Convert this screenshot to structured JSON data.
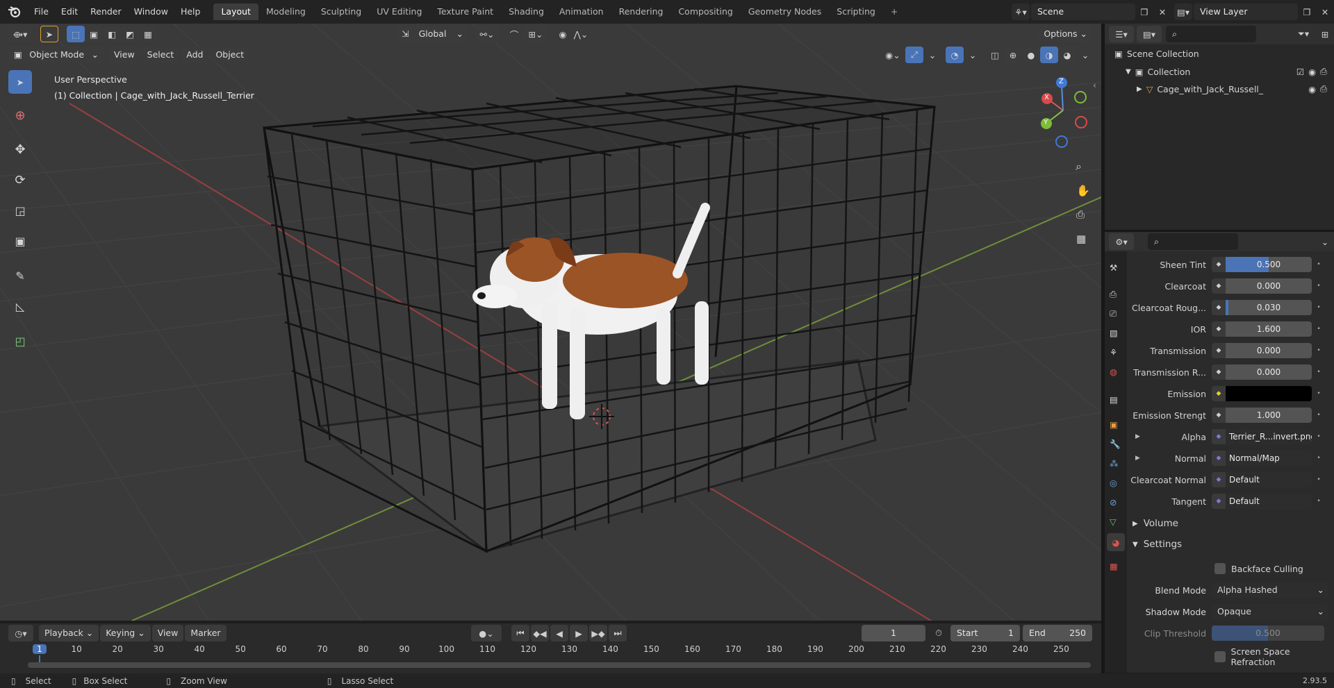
{
  "app": {
    "version": "2.93.5"
  },
  "menu": [
    "File",
    "Edit",
    "Render",
    "Window",
    "Help"
  ],
  "workspaces": [
    "Layout",
    "Modeling",
    "Sculpting",
    "UV Editing",
    "Texture Paint",
    "Shading",
    "Animation",
    "Rendering",
    "Compositing",
    "Geometry Nodes",
    "Scripting"
  ],
  "active_workspace": "Layout",
  "scene": {
    "name": "Scene"
  },
  "view_layer": {
    "name": "View Layer"
  },
  "viewport_header": {
    "mode": "Object Mode",
    "menus": [
      "View",
      "Select",
      "Add",
      "Object"
    ],
    "orientation": "Global",
    "options": "Options"
  },
  "viewport": {
    "perspective": "User Perspective",
    "context": "(1) Collection | Cage_with_Jack_Russell_Terrier",
    "gizmo_axes": [
      "X",
      "Y",
      "Z"
    ]
  },
  "outliner": {
    "root": "Scene Collection",
    "collection": "Collection",
    "object": "Cage_with_Jack_Russell_"
  },
  "properties": {
    "rows": [
      {
        "label": "Sheen Tint",
        "value": "0.500",
        "fill": 0.5
      },
      {
        "label": "Clearcoat",
        "value": "0.000",
        "fill": 0
      },
      {
        "label": "Clearcoat Roug...",
        "value": "0.030",
        "fill": 0.03
      },
      {
        "label": "IOR",
        "value": "1.600",
        "fill": 0
      },
      {
        "label": "Transmission",
        "value": "0.000",
        "fill": 0
      },
      {
        "label": "Transmission R...",
        "value": "0.000",
        "fill": 0
      },
      {
        "label": "Emission",
        "value": "",
        "fill": 0
      },
      {
        "label": "Emission Strengt",
        "value": "1.000",
        "fill": 0
      },
      {
        "label": "Alpha",
        "value": "Terrier_R...invert.png",
        "fill": 0
      },
      {
        "label": "Normal",
        "value": "Normal/Map",
        "fill": 0
      },
      {
        "label": "Clearcoat Normal",
        "value": "Default",
        "fill": 0
      },
      {
        "label": "Tangent",
        "value": "Default",
        "fill": 0
      }
    ],
    "volume_panel": "Volume",
    "settings_panel": "Settings",
    "backface_culling": "Backface Culling",
    "blend_mode_label": "Blend Mode",
    "blend_mode": "Alpha Hashed",
    "shadow_mode_label": "Shadow Mode",
    "shadow_mode": "Opaque",
    "clip_threshold_label": "Clip Threshold",
    "clip_threshold": "0.500",
    "ssr": "Screen Space Refraction"
  },
  "timeline": {
    "menus": [
      "Playback",
      "Keying",
      "View",
      "Marker"
    ],
    "current_frame": "1",
    "start_label": "Start",
    "start": "1",
    "end_label": "End",
    "end": "250",
    "ticks": [
      "1",
      "10",
      "20",
      "30",
      "40",
      "50",
      "60",
      "70",
      "80",
      "90",
      "100",
      "110",
      "120",
      "130",
      "140",
      "150",
      "160",
      "170",
      "180",
      "190",
      "200",
      "210",
      "220",
      "230",
      "240",
      "250"
    ]
  },
  "statusbar": {
    "select": "Select",
    "box_select": "Box Select",
    "zoom_view": "Zoom View",
    "lasso_select": "Lasso Select"
  }
}
